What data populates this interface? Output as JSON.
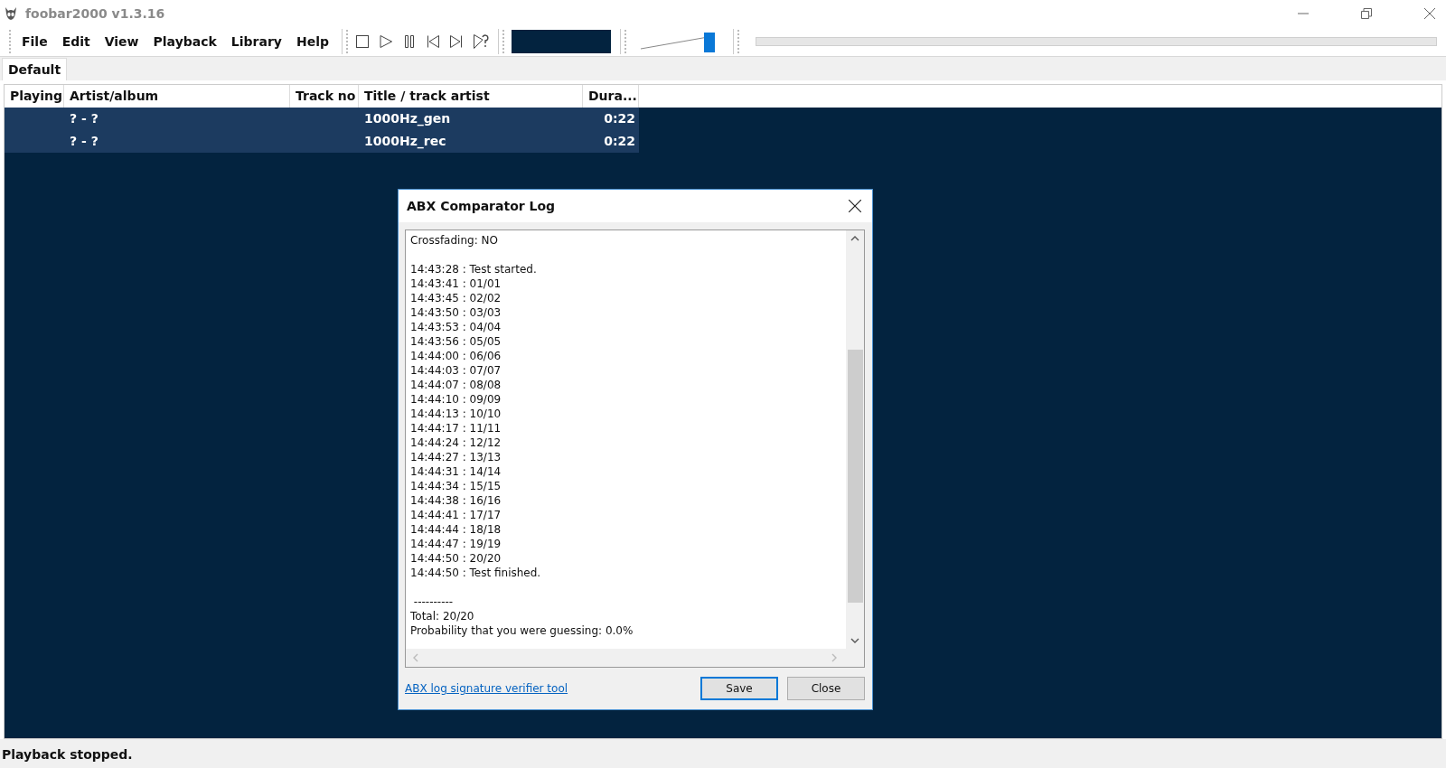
{
  "window": {
    "title": "foobar2000 v1.3.16"
  },
  "menu": [
    "File",
    "Edit",
    "View",
    "Playback",
    "Library",
    "Help"
  ],
  "volume": {
    "level": 0.93
  },
  "tabs": [
    {
      "label": "Default",
      "selected": true
    }
  ],
  "playlist": {
    "columns": [
      "Playing",
      "Artist/album",
      "Track no",
      "Title / track artist",
      "Dura..."
    ],
    "rows": [
      {
        "selected": true,
        "cells": [
          "",
          "? - ?",
          "",
          "1000Hz_gen",
          "0:22"
        ]
      },
      {
        "selected": true,
        "cells": [
          "",
          "? - ?",
          "",
          "1000Hz_rec",
          "0:22"
        ]
      }
    ]
  },
  "dialog": {
    "title": "ABX Comparator Log",
    "log": [
      [
        "Crossfading: NO"
      ],
      [
        "14:43:28 : Test started.",
        "14:43:41 : 01/01",
        "14:43:45 : 02/02",
        "14:43:50 : 03/03",
        "14:43:53 : 04/04",
        "14:43:56 : 05/05",
        "14:44:00 : 06/06",
        "14:44:03 : 07/07",
        "14:44:07 : 08/08",
        "14:44:10 : 09/09",
        "14:44:13 : 10/10",
        "14:44:17 : 11/11",
        "14:44:24 : 12/12",
        "14:44:27 : 13/13",
        "14:44:31 : 14/14",
        "14:44:34 : 15/15",
        "14:44:38 : 16/16",
        "14:44:41 : 17/17",
        "14:44:44 : 18/18",
        "14:44:47 : 19/19",
        "14:44:50 : 20/20",
        "14:44:50 : Test finished."
      ],
      [
        " ----------",
        "Total: 20/20",
        "Probability that you were guessing: 0.0%"
      ]
    ],
    "link": "ABX log signature verifier tool",
    "buttons": [
      {
        "label": "Save",
        "default": true
      },
      {
        "label": "Close",
        "default": false
      }
    ]
  },
  "status_bar": "Playback stopped."
}
